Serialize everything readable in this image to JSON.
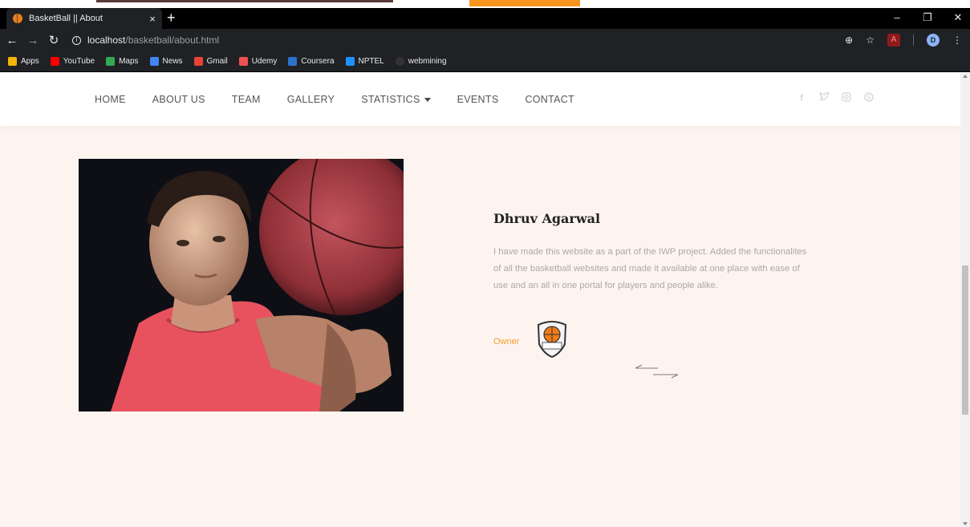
{
  "browser": {
    "tab_title": "BasketBall || About",
    "tab_close": "×",
    "new_tab": "+",
    "window_controls": [
      "–",
      "❐",
      "✕"
    ],
    "url_host": "localhost",
    "url_path": "/basketball/about.html",
    "profile_initial": "D",
    "bookmarks": [
      {
        "label": "Apps",
        "icon": "apps-grid-icon",
        "color": "#f4b400"
      },
      {
        "label": "YouTube",
        "icon": "youtube-icon",
        "color": "#ff0000"
      },
      {
        "label": "Maps",
        "icon": "maps-icon",
        "color": "#34a853"
      },
      {
        "label": "News",
        "icon": "news-icon",
        "color": "#4285f4"
      },
      {
        "label": "Gmail",
        "icon": "gmail-icon",
        "color": "#ea4335"
      },
      {
        "label": "Udemy",
        "icon": "udemy-icon",
        "color": "#ec5252"
      },
      {
        "label": "Coursera",
        "icon": "coursera-icon",
        "color": "#2a73cc"
      },
      {
        "label": "NPTEL",
        "icon": "nptel-icon",
        "color": "#1e90ff"
      },
      {
        "label": "webmining",
        "icon": "github-icon",
        "color": "#333333"
      }
    ]
  },
  "site": {
    "nav": {
      "home": "HOME",
      "about": "ABOUT US",
      "team": "TEAM",
      "gallery": "GALLERY",
      "statistics": "STATISTICS",
      "events": "EVENTS",
      "contact": "CONTACT"
    },
    "social_icons": [
      "facebook-icon",
      "twitter-icon",
      "instagram-icon",
      "skype-icon"
    ],
    "profile": {
      "name": "Dhruv Agarwal",
      "bio": "I have made this website as a part of the IWP project. Added the functionalites of all the basketball websites and made it available at one place with ease of use and an all in one portal for players and people alike.",
      "role": "Owner"
    },
    "colors": {
      "accent": "#f0a02a",
      "background": "#fdf4ef",
      "jersey": "#e8525f"
    }
  }
}
